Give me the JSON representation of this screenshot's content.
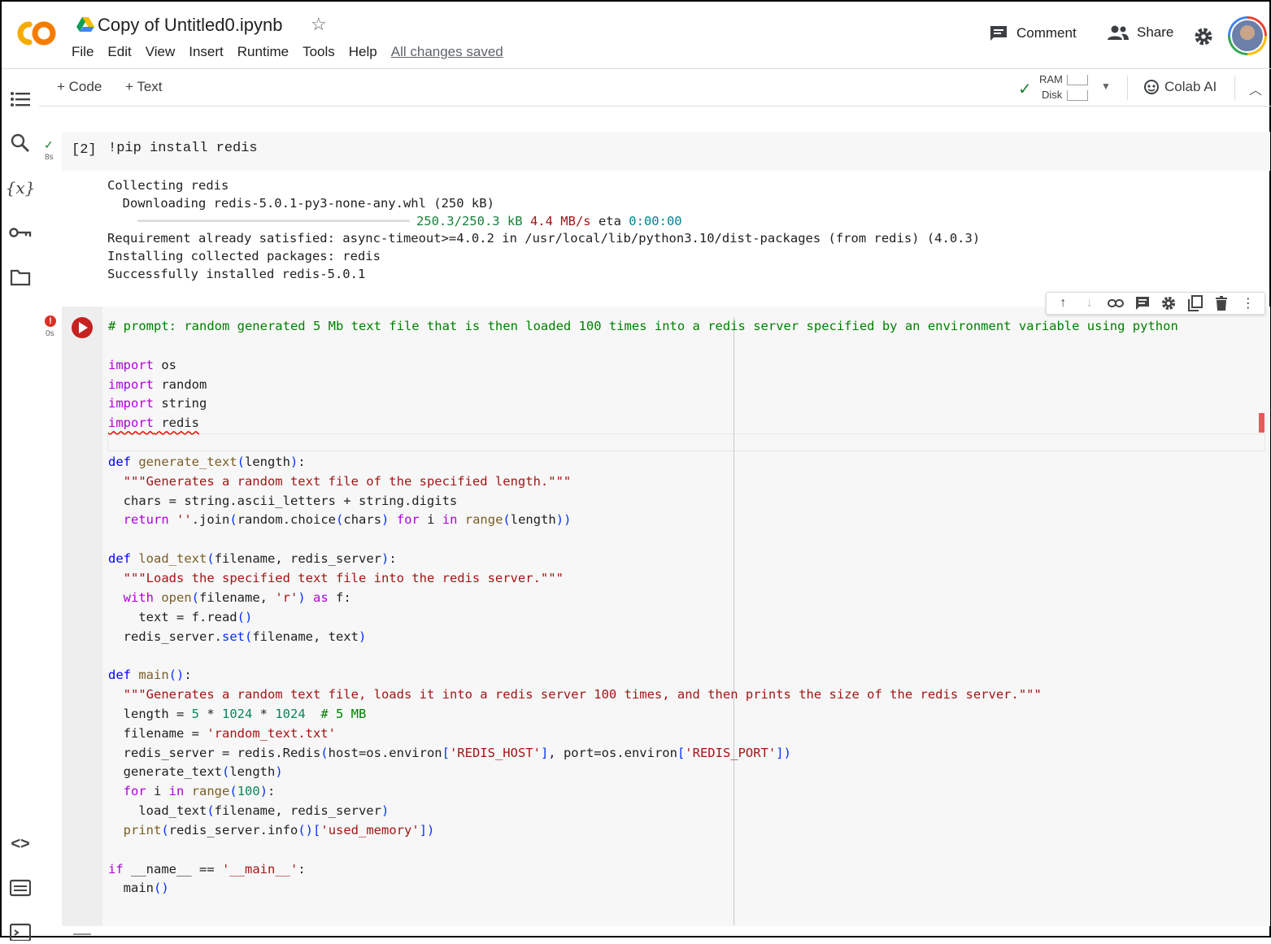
{
  "header": {
    "logo_text": "CO",
    "title": "Copy of Untitled0.ipynb",
    "menu": [
      "File",
      "Edit",
      "View",
      "Insert",
      "Runtime",
      "Tools",
      "Help"
    ],
    "save_status": "All changes saved",
    "comment_label": "Comment",
    "share_label": "Share"
  },
  "toolbar": {
    "add_code": "+ Code",
    "add_text": "+ Text",
    "ram_label": "RAM",
    "disk_label": "Disk",
    "colab_ai": "Colab AI"
  },
  "cell1": {
    "execution_count": "[2]",
    "run_time": "8s",
    "code": "!pip install redis",
    "output": {
      "line1": "Collecting redis",
      "line2": "  Downloading redis-5.0.1-py3-none-any.whl (250 kB)",
      "progress_bar": "━━━━━━━━━━━━━━━━━━━━━━━━━━━━━━━━━━━━━━━━",
      "progress_size": "250.3/250.3 kB",
      "progress_speed": "4.4 MB/s",
      "progress_eta_label": "eta",
      "progress_eta": "0:00:00",
      "line4": "Requirement already satisfied: async-timeout>=4.0.2 in /usr/local/lib/python3.10/dist-packages (from redis) (4.0.3)",
      "line5": "Installing collected packages: redis",
      "line6": "Successfully installed redis-5.0.1"
    }
  },
  "cell2": {
    "run_time": "0s",
    "error_badge": "!",
    "code_lines": [
      "# prompt: random generated 5 Mb text file that is then loaded 100 times into a redis server specified by an environment variable using python",
      "",
      "import os",
      "import random",
      "import string",
      "import redis",
      "",
      "def generate_text(length):",
      "  \"\"\"Generates a random text file of the specified length.\"\"\"",
      "  chars = string.ascii_letters + string.digits",
      "  return ''.join(random.choice(chars) for i in range(length))",
      "",
      "def load_text(filename, redis_server):",
      "  \"\"\"Loads the specified text file into the redis server.\"\"\"",
      "  with open(filename, 'r') as f:",
      "    text = f.read()",
      "  redis_server.set(filename, text)",
      "",
      "def main():",
      "  \"\"\"Generates a random text file, loads it into a redis server 100 times, and then prints the size of the redis server.\"\"\"",
      "  length = 5 * 1024 * 1024  # 5 MB",
      "  filename = 'random_text.txt'",
      "  redis_server = redis.Redis(host=os.environ['REDIS_HOST'], port=os.environ['REDIS_PORT'])",
      "  generate_text(length)",
      "  for i in range(100):",
      "    load_text(filename, redis_server)",
      "  print(redis_server.info()['used_memory'])",
      "",
      "if __name__ == '__main__':",
      "  main()"
    ]
  },
  "icons": {
    "rail": [
      "table-of-contents-icon",
      "search-icon",
      "variables-icon",
      "secrets-key-icon",
      "files-folder-icon",
      "code-snippets-icon",
      "command-palette-icon",
      "terminal-icon"
    ],
    "cell_toolbar": [
      "move-up-icon",
      "move-down-icon",
      "link-icon",
      "comment-icon",
      "settings-icon",
      "mirror-cell-icon",
      "delete-icon",
      "more-vert-icon"
    ]
  },
  "colors": {
    "logo_orange": "#f9ab00",
    "run_error_red": "#c5221f",
    "success_green": "#188038"
  }
}
